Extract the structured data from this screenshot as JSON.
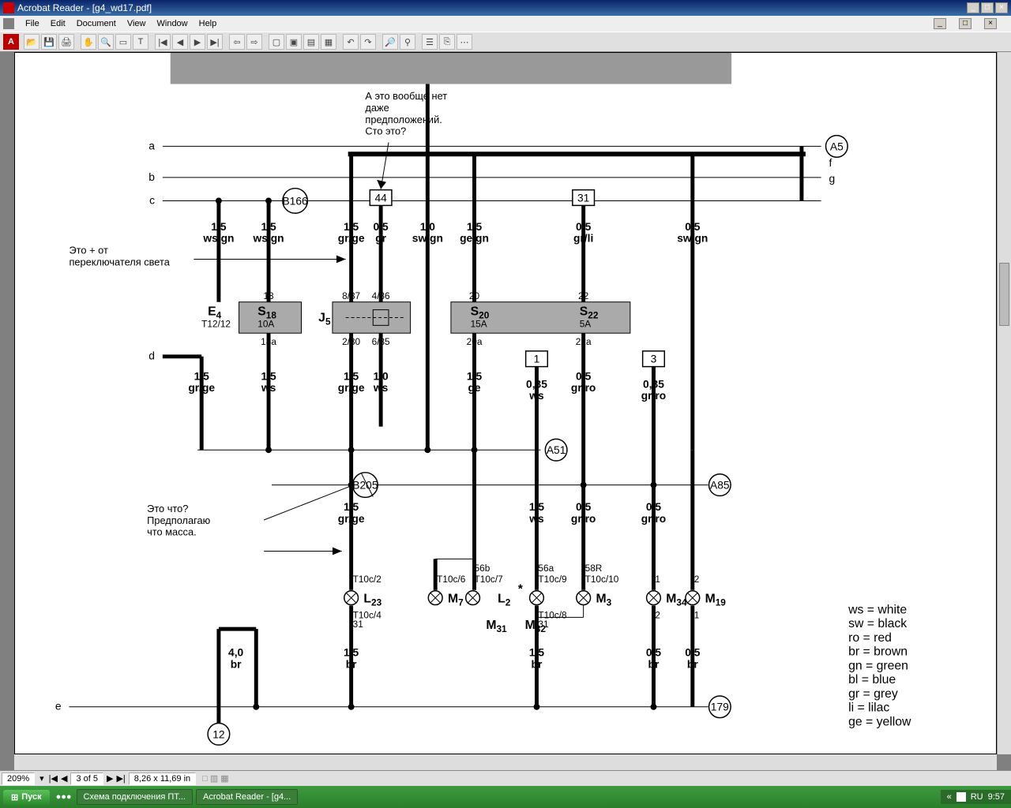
{
  "window": {
    "title": "Acrobat Reader - [g4_wd17.pdf]"
  },
  "menu": {
    "file": "File",
    "edit": "Edit",
    "document": "Document",
    "view": "View",
    "window": "Window",
    "help": "Help"
  },
  "status": {
    "zoom": "209%",
    "page": "3 of 5",
    "dims": "8,26 x 11,69 in"
  },
  "taskbar": {
    "start": "Пуск",
    "tab1": "Схема подключения ПТ...",
    "tab2": "Acrobat Reader - [g4...",
    "lang": "RU",
    "time": "9:57"
  },
  "annotations": {
    "top": "А это вообще нет\nдаже\nпредположений.\nСто это?",
    "left": "Это + от\nпереключателя света",
    "mid": "Это что?\nПредполагаю\nчто масса."
  },
  "legend": {
    "ws": "ws = white",
    "sw": "sw = black",
    "ro": "ro  = red",
    "br": "br  = brown",
    "gn": "gn = green",
    "bl": "bl  = blue",
    "gr": "gr  = grey",
    "li": "li   = lilac",
    "ge": "ge = yellow"
  },
  "nodes": {
    "a": "a",
    "b": "b",
    "c": "c",
    "d": "d",
    "e": "e",
    "f": "f",
    "g": "g",
    "A5": "A5",
    "B166": "B166",
    "A51": "A51",
    "B205": "B205",
    "A85": "A85",
    "n179": "179",
    "n12": "12",
    "box44": "44",
    "box31": "31",
    "box1": "1",
    "box3": "3"
  },
  "components": {
    "E4": "E",
    "E4sub": "4",
    "E4pin": "T12/12",
    "S18": "S",
    "S18sub": "18",
    "S18rating": "10A",
    "J5": "J",
    "J5sub": "5",
    "S20": "S",
    "S20sub": "20",
    "S20rating": "15A",
    "S22": "S",
    "S22sub": "22",
    "S22rating": "5A",
    "L23": "L",
    "L23sub": "23",
    "M7": "M",
    "M7sub": "7",
    "L2": "L",
    "L2sub": "2",
    "L2star": "*",
    "M3": "M",
    "M3sub": "3",
    "M31": "M",
    "M31sub": "31",
    "M32": "M",
    "M32sub": "32",
    "M34": "M",
    "M34sub": "34",
    "M19": "M",
    "M19sub": "19"
  },
  "wires": {
    "w1_5_wsgn_a": "1,5",
    "w1_5_wsgn_a2": "ws/gn",
    "w1_5_wsgn_b": "1,5",
    "w1_5_wsgn_b2": "ws/gn",
    "w1_5_grge": "1,5",
    "w1_5_grge2": "gr/ge",
    "w0_5_gr": "0,5",
    "w0_5_gr2": "gr",
    "w1_0_swgn": "1,0",
    "w1_0_swgn2": "sw/gn",
    "w1_5_gegn": "1,5",
    "w1_5_gegn2": "ge/gn",
    "w0_5_grli": "0,5",
    "w0_5_grli2": "gr/li",
    "w0_5_swgn": "0,5",
    "w0_5_swgn2": "sw/gn",
    "pin18": "18",
    "pin887": "8/87",
    "pin486": "4/86",
    "pin20": "20",
    "pin22": "22",
    "pin18a": "18a",
    "pin230": "2/30",
    "pin685": "6/85",
    "pin20a": "20a",
    "pin22a": "22a",
    "w1_5_grge_d": "1,5",
    "w1_5_grge_d2": "gr/ge",
    "w1_5_ws": "1,5",
    "w1_5_ws2": "ws",
    "w1_5_grge_c": "1,5",
    "w1_5_grge_c2": "gr/ge",
    "w1_0_ws": "1,0",
    "w1_0_ws2": "ws",
    "w1_5_ge": "1,5",
    "w1_5_ge2": "ge",
    "w0_35_ws": "0,35",
    "w0_35_ws2": "ws",
    "w0_5_grro": "0,5",
    "w0_5_grro2": "gr/ro",
    "w0_35_grro": "0,35",
    "w0_35_grro2": "gr/ro",
    "w1_5_grge_e": "1,5",
    "w1_5_grge_e2": "gr/ge",
    "w1_5_ws_f": "1,5",
    "w1_5_ws_f2": "ws",
    "w0_5_grro_f": "0,5",
    "w0_5_grro_f2": "gr/ro",
    "w0_5_grro_g": "0,5",
    "w0_5_grro_g2": "gr/ro",
    "t10c2": "T10c/2",
    "t10c6": "T10c/6",
    "t10c7": "T10c/7",
    "t56b": "56b",
    "t56a": "56a",
    "t10c9": "T10c/9",
    "t58R": "58R",
    "t10c10": "T10c/10",
    "tp1": "1",
    "tp2": "2",
    "t10c4": "T10c/4",
    "t31": "31",
    "t10c8": "T10c/8",
    "t31b": "31",
    "bp1": "1",
    "bp2": "2",
    "w4_0_br": "4,0",
    "w4_0_br2": "br",
    "w1_5_br": "1,5",
    "w1_5_br2": "br",
    "w1_5_br_b": "1,5",
    "w1_5_br_b2": "br",
    "w0_5_br": "0,5",
    "w0_5_br2": "br",
    "w0_5_br_b": "0,5",
    "w0_5_br_b2": "br"
  }
}
